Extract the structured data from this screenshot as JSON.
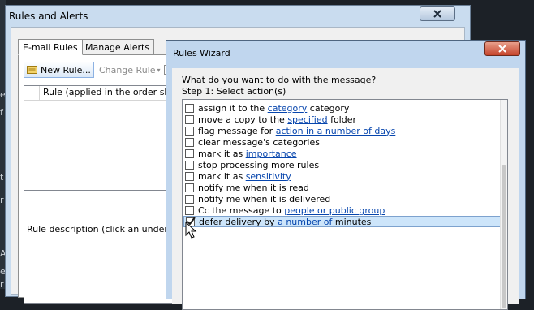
{
  "background": {
    "edge_letters": [
      "e",
      "f",
      "t",
      "r",
      "A",
      "e",
      "r"
    ]
  },
  "rules_and_alerts": {
    "title": "Rules and Alerts",
    "tabs": [
      {
        "label": "E-mail Rules",
        "active": true
      },
      {
        "label": "Manage Alerts",
        "active": false
      }
    ],
    "toolbar": {
      "new_rule_label": "New Rule...",
      "change_rule_label": "Change Rule"
    },
    "rule_list_header": "Rule (applied in the order shown)",
    "description_label": "Rule description (click an underlined"
  },
  "rules_wizard": {
    "title": "Rules Wizard",
    "question": "What do you want to do with the message?",
    "step": "Step 1: Select action(s)",
    "actions": [
      {
        "pre": "assign it to the ",
        "link": "category",
        "post": " category",
        "checked": false
      },
      {
        "pre": "move a copy to the ",
        "link": "specified",
        "post": " folder",
        "checked": false
      },
      {
        "pre": "flag message for ",
        "link": "action in a number of days",
        "post": "",
        "checked": false
      },
      {
        "pre": "clear message's categories",
        "link": "",
        "post": "",
        "checked": false
      },
      {
        "pre": "mark it as ",
        "link": "importance",
        "post": "",
        "checked": false
      },
      {
        "pre": "stop processing more rules",
        "link": "",
        "post": "",
        "checked": false
      },
      {
        "pre": "mark it as ",
        "link": "sensitivity",
        "post": "",
        "checked": false
      },
      {
        "pre": "notify me when it is read",
        "link": "",
        "post": "",
        "checked": false
      },
      {
        "pre": "notify me when it is delivered",
        "link": "",
        "post": "",
        "checked": false
      },
      {
        "pre": "Cc the message to ",
        "link": "people or public group",
        "post": "",
        "checked": false
      },
      {
        "pre": "defer delivery by ",
        "link": "a number of",
        "post": " minutes",
        "checked": true,
        "selected": true
      }
    ]
  },
  "colors": {
    "link": "#0645ad",
    "selection": "#cde5fa",
    "wizard_close": "#c5432a"
  }
}
